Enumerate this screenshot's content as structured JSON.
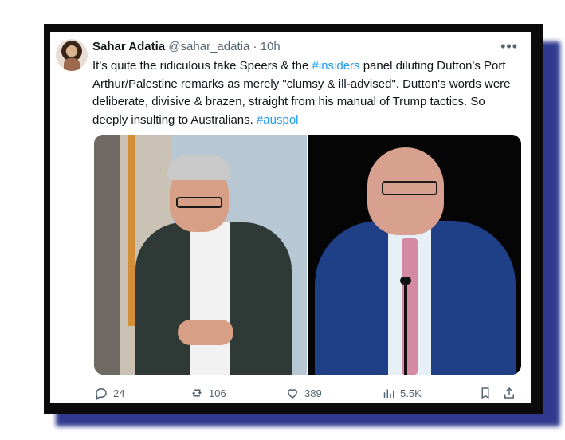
{
  "tweet": {
    "author_name": "Sahar Adatia",
    "author_handle": "@sahar_adatia",
    "separator": "·",
    "time": "10h",
    "more_label": "•••",
    "text_part1": "It's quite the ridiculous take Speers & the ",
    "hashtag_insiders": "#insiders",
    "text_part2": " panel diluting Dutton's Port Arthur/Palestine remarks as merely \"clumsy & ill-advised\". Dutton's words were deliberate, divisive & brazen, straight from his manual of Trump tactics. So deeply insulting to Australians. ",
    "hashtag_auspol": "#auspol"
  },
  "actions": {
    "replies": "24",
    "retweets": "106",
    "likes": "389",
    "views": "5.5K"
  },
  "colors": {
    "accent": "#1d9bf0",
    "shadow": "#2f3a8f",
    "frame": "#0b0b0b"
  },
  "icons": {
    "reply": "reply-icon",
    "retweet": "retweet-icon",
    "like": "like-icon",
    "views": "views-icon",
    "bookmark": "bookmark-icon",
    "share": "share-icon"
  }
}
